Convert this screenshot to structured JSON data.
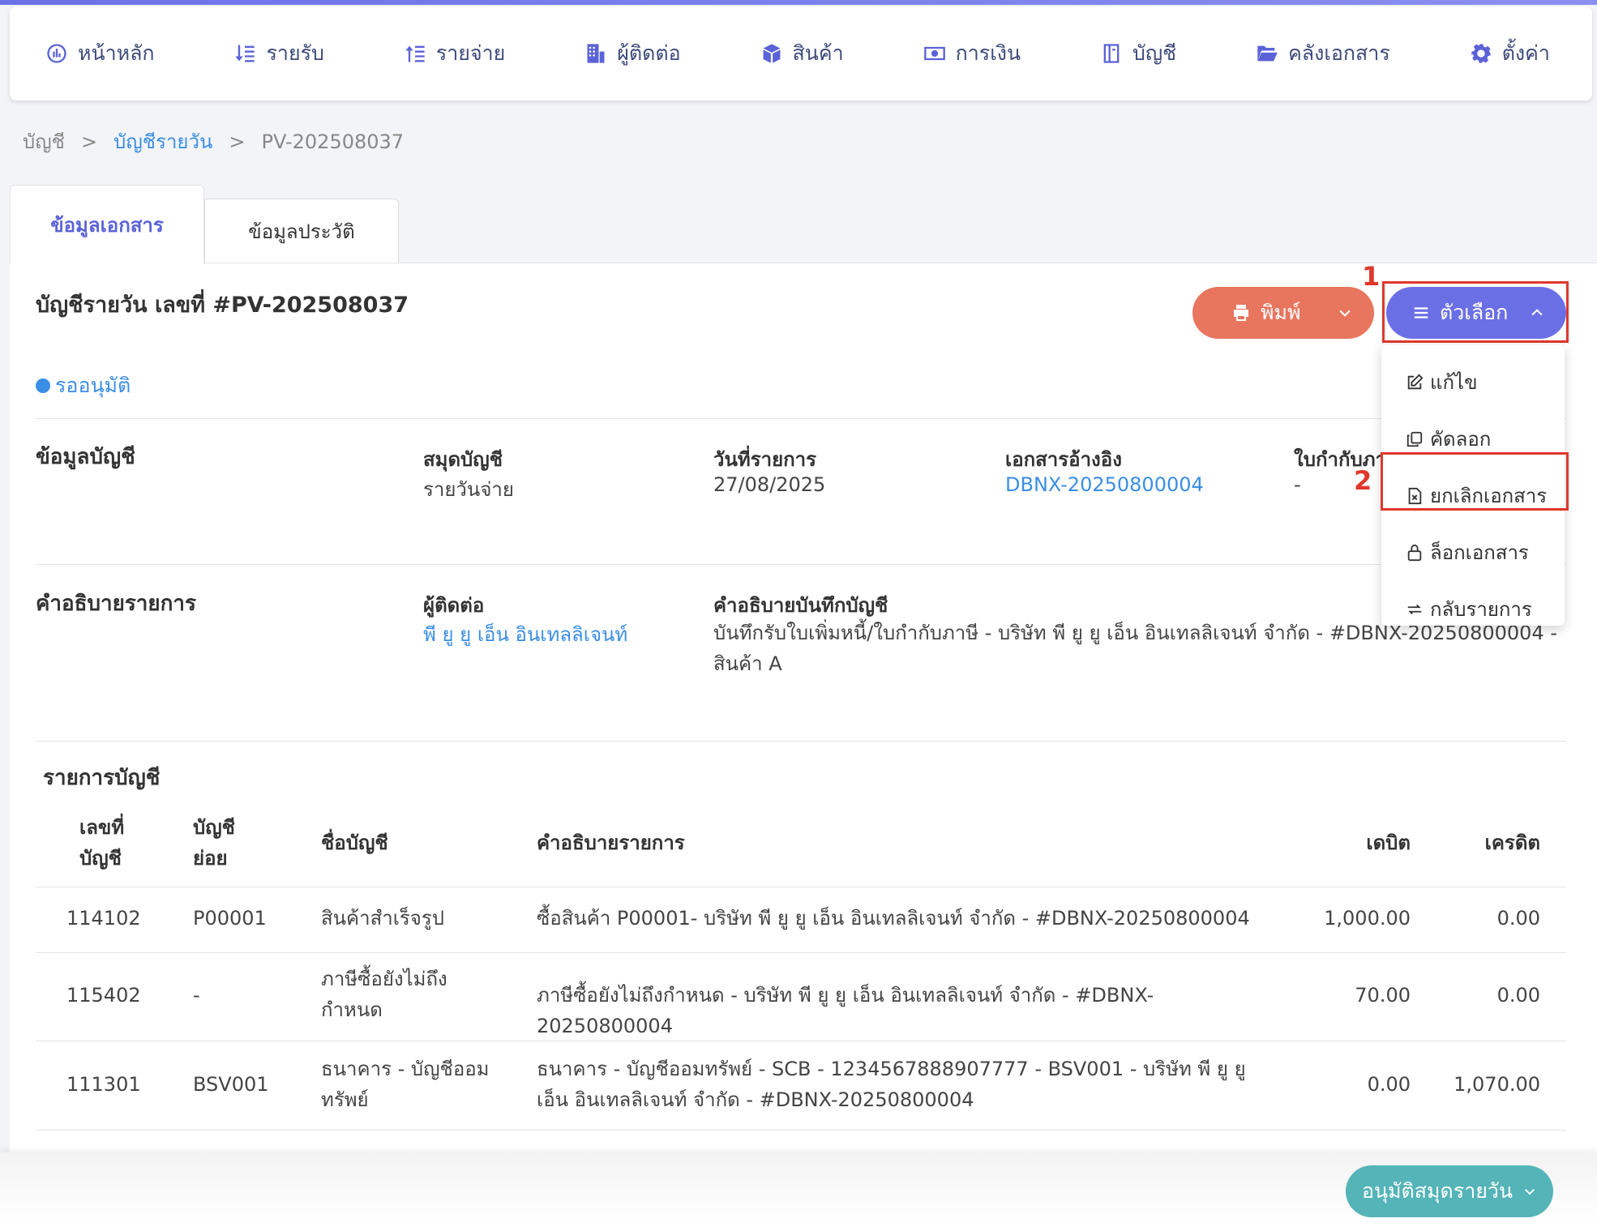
{
  "nav": {
    "items": [
      {
        "label": "หน้าหลัก",
        "icon": "dashboard-icon"
      },
      {
        "label": "รายรับ",
        "icon": "income-icon"
      },
      {
        "label": "รายจ่าย",
        "icon": "expense-icon"
      },
      {
        "label": "ผู้ติดต่อ",
        "icon": "contacts-icon"
      },
      {
        "label": "สินค้า",
        "icon": "box-icon"
      },
      {
        "label": "การเงิน",
        "icon": "money-icon"
      },
      {
        "label": "บัญชี",
        "icon": "book-icon"
      },
      {
        "label": "คลังเอกสาร",
        "icon": "folder-icon"
      },
      {
        "label": "ตั้งค่า",
        "icon": "gear-icon"
      }
    ]
  },
  "breadcrumb": {
    "root": "บัญชี",
    "sep": ">",
    "parent": "บัญชีรายวัน",
    "current": "PV-202508037"
  },
  "tabs": {
    "active": "ข้อมูลเอกสาร",
    "inactive": "ข้อมูลประวัติ"
  },
  "document": {
    "title": "บัญชีรายวัน เลขที่ #PV-202508037",
    "status": "รออนุมัติ"
  },
  "actions": {
    "print_label": "พิมพ์",
    "options_label": "ตัวเลือก",
    "annotation_1": "1",
    "annotation_2": "2",
    "menu": [
      {
        "label": "แก้ไข",
        "icon": "edit-icon"
      },
      {
        "label": "คัดลอก",
        "icon": "copy-icon"
      },
      {
        "label": "ยกเลิกเอกสาร",
        "icon": "cancel-document-icon"
      },
      {
        "label": "ล็อกเอกสาร",
        "icon": "lock-icon"
      },
      {
        "label": "กลับรายการ",
        "icon": "reverse-icon"
      }
    ]
  },
  "account_info": {
    "section_title": "ข้อมูลบัญชี",
    "journal_label": "สมุดบัญชี",
    "journal_value": "รายวันจ่าย",
    "date_label": "วันที่รายการ",
    "date_value": "27/08/2025",
    "ref_label": "เอกสารอ้างอิง",
    "ref_value": "DBNX-20250800004",
    "tax_invoice_label": "ใบกำกับภา",
    "tax_invoice_value": "-"
  },
  "description_info": {
    "section_title": "คำอธิบายรายการ",
    "contact_label": "ผู้ติดต่อ",
    "contact_value": "พี ยู ยู เอ็น อินเทลลิเจนท์",
    "memo_label": "คำอธิบายบันทึกบัญชี",
    "memo_value": "บันทึกรับใบเพิ่มหนี้/ใบกำกับภาษี - บริษัท พี ยู ยู เอ็น อินเทลลิเจนท์ จำกัด - #DBNX-20250800004 - สินค้า A"
  },
  "entries": {
    "section_title": "รายการบัญชี",
    "headers": {
      "account_no": "เลขที่ บัญชี",
      "sub_account": "บัญชี ย่อย",
      "account_name": "ชื่อบัญชี",
      "description": "คำอธิบายรายการ",
      "debit": "เดบิต",
      "credit": "เครดิต"
    },
    "rows": [
      {
        "account_no": "114102",
        "sub_account": "P00001",
        "account_name": "สินค้าสำเร็จรูป",
        "description": "ซื้อสินค้า P00001- บริษัท พี ยู ยู เอ็น อินเทลลิเจนท์ จำกัด - #DBNX-20250800004",
        "debit": "1,000.00",
        "credit": "0.00"
      },
      {
        "account_no": "115402",
        "sub_account": "-",
        "account_name": "ภาษีซื้อยังไม่ถึงกำหนด",
        "description": "ภาษีซื้อยังไม่ถึงกำหนด - บริษัท พี ยู ยู เอ็น อินเทลลิเจนท์ จำกัด - #DBNX-20250800004",
        "debit": "70.00",
        "credit": "0.00"
      },
      {
        "account_no": "111301",
        "sub_account": "BSV001",
        "account_name": "ธนาคาร - บัญชีออมทรัพย์",
        "description": "ธนาคาร - บัญชีออมทรัพย์ - SCB - 1234567888907777 - BSV001 - บริษัท พี ยู ยู เอ็น อินเทลลิเจนท์ จำกัด - #DBNX-20250800004",
        "debit": "0.00",
        "credit": "1,070.00"
      }
    ]
  },
  "footer": {
    "approve_label": "อนุมัติสมุดรายวัน"
  },
  "colors": {
    "primary": "#6b6fe6",
    "print_button": "#e8755e",
    "approve_button": "#54b4b8",
    "link": "#3a8ee6",
    "highlight": "#e0382b"
  }
}
